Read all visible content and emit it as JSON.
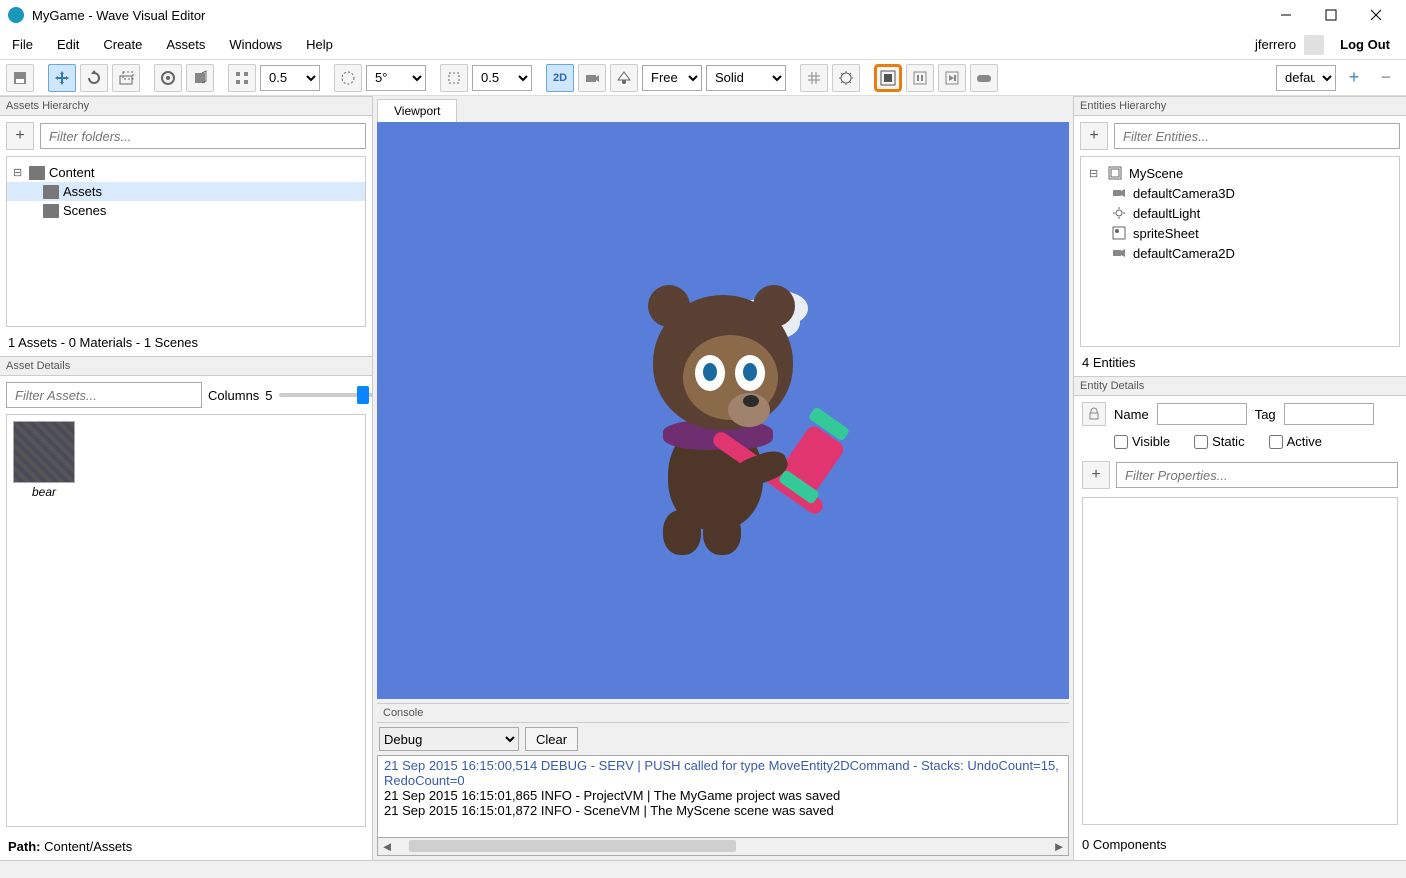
{
  "title": "MyGame - Wave Visual Editor",
  "menu": {
    "file": "File",
    "edit": "Edit",
    "create": "Create",
    "assets": "Assets",
    "windows": "Windows",
    "help": "Help"
  },
  "user": {
    "name": "jferrero",
    "logout": "Log Out"
  },
  "toolbar": {
    "snap1": "0.5",
    "angle": "5°",
    "snap2": "0.5",
    "mode2d": "2D",
    "camera": "Free",
    "shade": "Solid",
    "layout_selected": "default"
  },
  "left": {
    "assets_hier": "Assets Hierarchy",
    "filter_folders_ph": "Filter folders...",
    "tree": {
      "root": "Content",
      "children": [
        "Assets",
        "Scenes"
      ]
    },
    "assets_status": "1 Assets - 0 Materials - 1 Scenes",
    "asset_details": "Asset Details",
    "filter_assets_ph": "Filter Assets...",
    "columns_label": "Columns",
    "columns_value": "5",
    "thumb1": "bear",
    "path_label": "Path:",
    "path_value": " Content/Assets"
  },
  "center": {
    "viewport_tab": "Viewport",
    "console": "Console",
    "console_level": "Debug",
    "clear": "Clear",
    "log1": "21 Sep 2015 16:15:00,514 DEBUG - SERV   | PUSH called for type MoveEntity2DCommand - Stacks: UndoCount=15, RedoCount=0",
    "log2": "21 Sep 2015 16:15:01,865 INFO - ProjectVM | The MyGame project was saved",
    "log3": "21 Sep 2015 16:15:01,872 INFO - SceneVM | The MyScene scene was saved"
  },
  "right": {
    "ent_hier": "Entities Hierarchy",
    "filter_entities_ph": "Filter Entities...",
    "root": "MyScene",
    "children": [
      "defaultCamera3D",
      "defaultLight",
      "spriteSheet",
      "defaultCamera2D"
    ],
    "ent_status": "4 Entities",
    "entity_details": "Entity Details",
    "name_lbl": "Name",
    "tag_lbl": "Tag",
    "visible": "Visible",
    "static": "Static",
    "active": "Active",
    "filter_props_ph": "Filter Properties...",
    "components": "0 Components"
  }
}
